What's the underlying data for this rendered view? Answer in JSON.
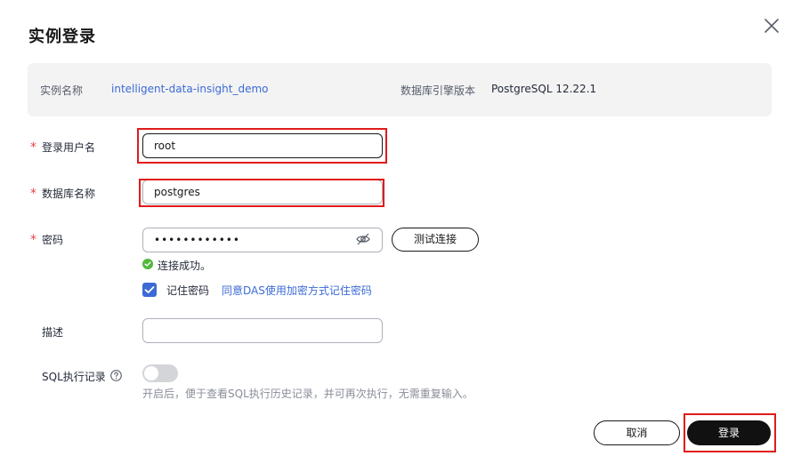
{
  "dialog": {
    "title": "实例登录"
  },
  "info": {
    "instance_name_label": "实例名称",
    "instance_name_value": "intelligent-data-insight_demo",
    "engine_version_label": "数据库引擎版本",
    "engine_version_value": "PostgreSQL 12.22.1"
  },
  "form": {
    "required_mark": "*",
    "username": {
      "label": "登录用户名",
      "value": "root"
    },
    "database": {
      "label": "数据库名称",
      "value": "postgres"
    },
    "password": {
      "label": "密码",
      "value": "••••••••••••"
    },
    "test_button": "测试连接",
    "success_message": "连接成功。",
    "remember": {
      "label": "记住密码",
      "checked": true,
      "link": "同意DAS使用加密方式记住密码"
    },
    "description": {
      "label": "描述",
      "value": ""
    },
    "sql_record": {
      "label": "SQL执行记录",
      "enabled": false,
      "hint": "开启后，便于查看SQL执行历史记录，并可再次执行，无需重复输入。"
    }
  },
  "footer": {
    "cancel_label": "取消",
    "login_label": "登录"
  },
  "colors": {
    "accent": "#3b6ad6",
    "required": "#e54545",
    "success": "#50b83c",
    "highlight_frame": "#e01b1b"
  },
  "icons": {
    "close": "close-icon",
    "eye": "eye-slash-icon",
    "success": "check-circle-icon",
    "checkbox": "checkmark-icon",
    "help": "question-circle-icon"
  }
}
